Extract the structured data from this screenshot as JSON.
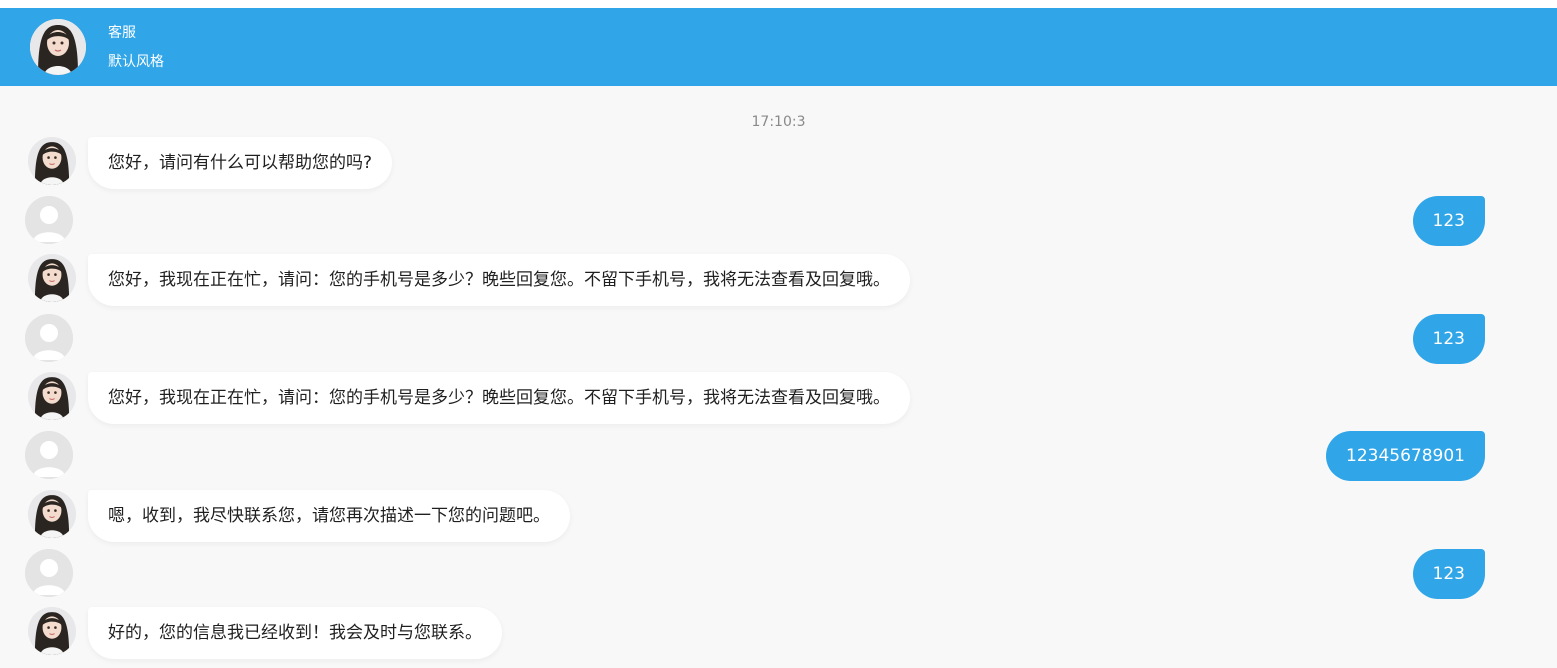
{
  "header": {
    "name": "客服",
    "style": "默认风格",
    "bar_color": "#30a5e8",
    "avatar_icon": "agent-avatar-icon"
  },
  "timestamp": "17:10:3",
  "messages": [
    {
      "from": "agent",
      "text": "您好，请问有什么可以帮助您的吗?"
    },
    {
      "from": "user",
      "text": "123"
    },
    {
      "from": "agent",
      "text": "您好，我现在正在忙，请问：您的手机号是多少？晚些回复您。不留下手机号，我将无法查看及回复哦。"
    },
    {
      "from": "user",
      "text": "123"
    },
    {
      "from": "agent",
      "text": "您好，我现在正在忙，请问：您的手机号是多少？晚些回复您。不留下手机号，我将无法查看及回复哦。"
    },
    {
      "from": "user",
      "text": "12345678901"
    },
    {
      "from": "agent",
      "text": "嗯，收到，我尽快联系您，请您再次描述一下您的问题吧。"
    },
    {
      "from": "user",
      "text": "123"
    },
    {
      "from": "agent",
      "text": "好的，您的信息我已经收到！我会及时与您联系。"
    }
  ]
}
